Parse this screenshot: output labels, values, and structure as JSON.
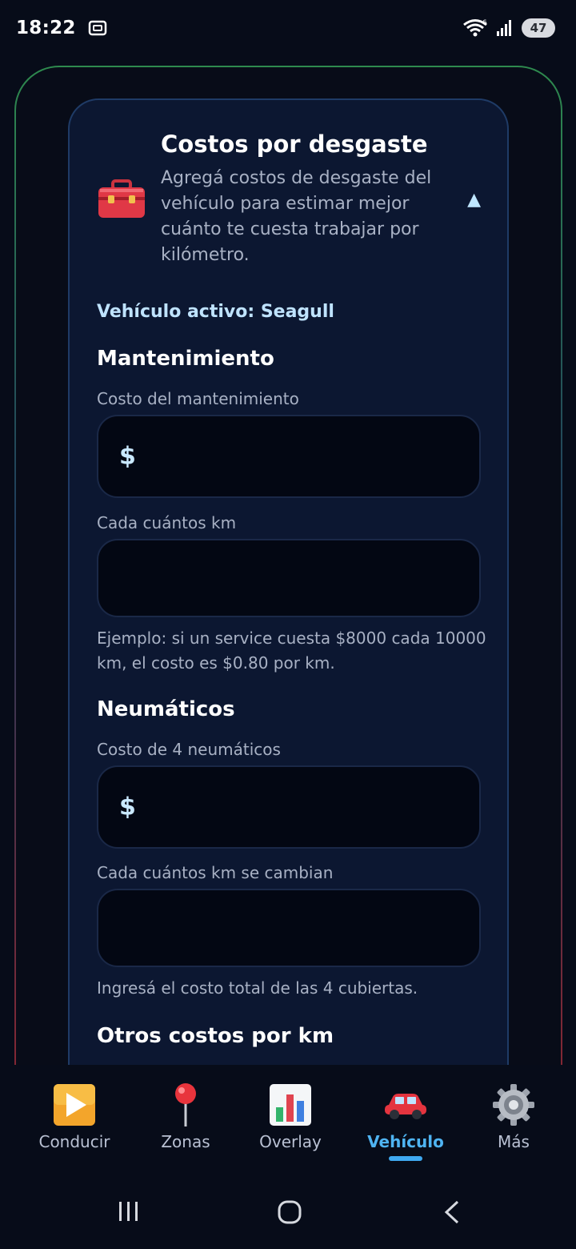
{
  "status_bar": {
    "time": "18:22",
    "wifi_badge": "6",
    "battery": "47"
  },
  "card": {
    "title": "Costos por desgaste",
    "description": "Agregá costos de desgaste del vehículo para estimar mejor cuánto te cuesta trabajar por kilómetro.",
    "active_vehicle": "Vehículo activo: Seagull",
    "maintenance": {
      "section_title": "Mantenimiento",
      "cost_label": "Costo del mantenimiento",
      "cost_prefix": "$",
      "km_label": "Cada cuántos km",
      "helper": "Ejemplo: si un service cuesta $8000 cada 10000 km, el costo es $0.80 por km."
    },
    "tires": {
      "section_title": "Neumáticos",
      "cost_label": "Costo de 4 neumáticos",
      "cost_prefix": "$",
      "km_label": "Cada cuántos km se cambian",
      "helper": "Ingresá el costo total de las 4 cubiertas."
    },
    "other_title": "Otros costos por km"
  },
  "bottom_nav": {
    "items": [
      {
        "label": "Conducir",
        "icon": "play-icon"
      },
      {
        "label": "Zonas",
        "icon": "pin-icon"
      },
      {
        "label": "Overlay",
        "icon": "chart-icon"
      },
      {
        "label": "Vehículo",
        "icon": "car-icon"
      },
      {
        "label": "Más",
        "icon": "gear-icon"
      }
    ],
    "active": "Vehículo"
  },
  "colors": {
    "accent": "#4fb4f2",
    "card_bg": "#0c1731",
    "input_bg": "#030713"
  }
}
